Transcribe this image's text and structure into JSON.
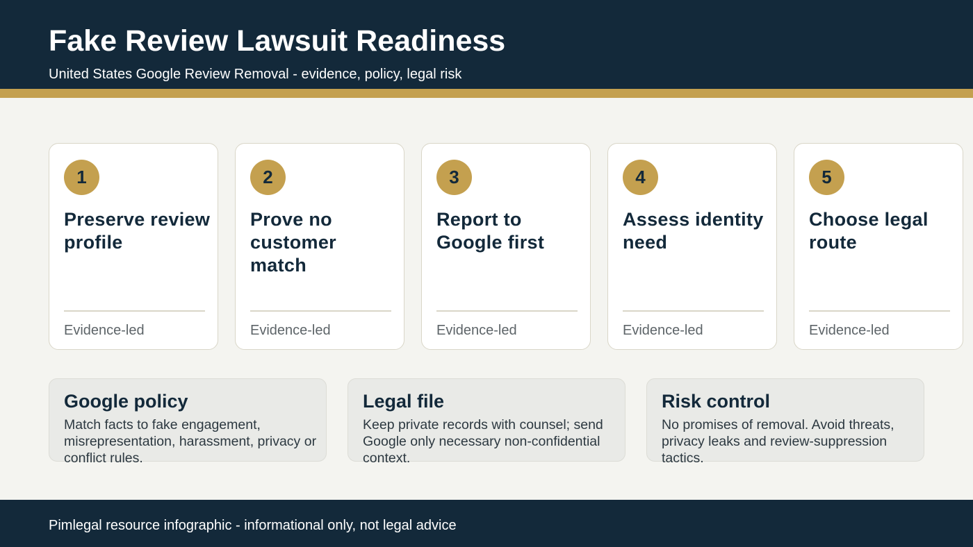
{
  "header": {
    "title": "Fake Review Lawsuit Readiness",
    "subtitle": "United States Google Review Removal - evidence, policy, legal risk"
  },
  "steps": [
    {
      "number": "1",
      "title": "Preserve review profile",
      "tag": "Evidence-led"
    },
    {
      "number": "2",
      "title": "Prove no customer match",
      "tag": "Evidence-led"
    },
    {
      "number": "3",
      "title": "Report to Google first",
      "tag": "Evidence-led"
    },
    {
      "number": "4",
      "title": "Assess identity need",
      "tag": "Evidence-led"
    },
    {
      "number": "5",
      "title": "Choose legal route",
      "tag": "Evidence-led"
    }
  ],
  "info_cards": [
    {
      "title": "Google policy",
      "text": "Match facts to fake engagement, misrepresentation, harassment, privacy or conflict rules."
    },
    {
      "title": "Legal file",
      "text": "Keep private records with counsel; send Google only necessary non-confidential context."
    },
    {
      "title": "Risk control",
      "text": "No promises of removal. Avoid threats, privacy leaks and review-suppression tactics."
    }
  ],
  "footer": {
    "text": "Pimlegal resource infographic - informational only, not legal advice"
  },
  "colors": {
    "navy": "#13293a",
    "gold": "#c4a04f",
    "background": "#f4f4f0"
  }
}
